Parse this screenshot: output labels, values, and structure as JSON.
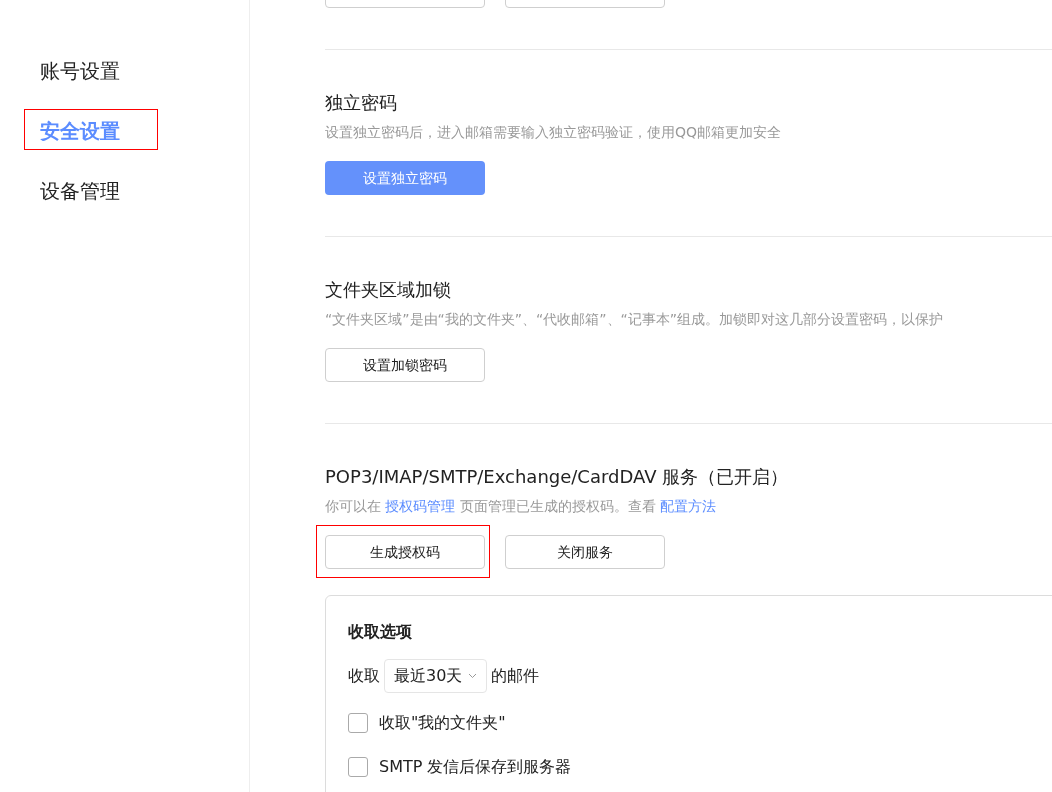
{
  "sidebar": {
    "items": [
      {
        "label": "账号设置",
        "selected": false,
        "annotated": false
      },
      {
        "label": "安全设置",
        "selected": true,
        "annotated": true
      },
      {
        "label": "设备管理",
        "selected": false,
        "annotated": false
      }
    ]
  },
  "top_buttons": [
    {
      "kind": "outline"
    },
    {
      "kind": "outline"
    }
  ],
  "sections": [
    {
      "title": "独立密码",
      "description": [
        {
          "text": "设置独立密码后，进入邮箱需要输入独立密码验证，使用QQ邮箱更加安全",
          "link": false
        }
      ],
      "buttons": [
        {
          "label": "设置独立密码",
          "primary": true,
          "annotated": false
        }
      ]
    },
    {
      "title": "文件夹区域加锁",
      "description": [
        {
          "text": "“文件夹区域”是由“我的文件夹”、“代收邮箱”、“记事本”组成。加锁即对这几部分设置密码，以保护",
          "link": false
        }
      ],
      "buttons": [
        {
          "label": "设置加锁密码",
          "primary": false,
          "annotated": false
        }
      ]
    },
    {
      "title": "POP3/IMAP/SMTP/Exchange/CardDAV 服务（已开启）",
      "description": [
        {
          "text": "你可以在 ",
          "link": false
        },
        {
          "text": "授权码管理",
          "link": true
        },
        {
          "text": " 页面管理已生成的授权码。查看 ",
          "link": false
        },
        {
          "text": "配置方法",
          "link": true
        }
      ],
      "buttons": [
        {
          "label": "生成授权码",
          "primary": false,
          "annotated": true
        },
        {
          "label": "关闭服务",
          "primary": false,
          "annotated": false
        }
      ]
    }
  ],
  "receive_options": {
    "title": "收取选项",
    "prefix": "收取",
    "select": "最近30天",
    "suffix": "的邮件",
    "checkboxes": [
      {
        "label": "收取\"我的文件夹\"",
        "checked": false
      },
      {
        "label": "SMTP 发信后保存到服务器",
        "checked": false
      }
    ]
  }
}
